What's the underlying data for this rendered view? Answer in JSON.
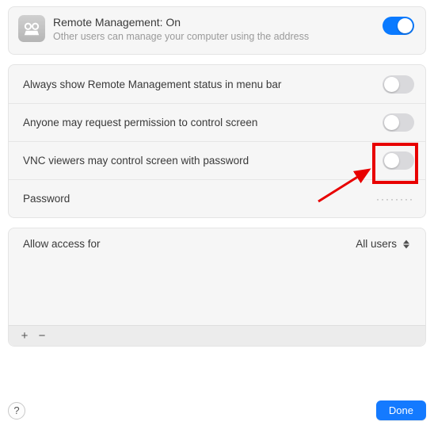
{
  "header": {
    "title": "Remote Management: On",
    "subtitle": "Other users can manage your computer using the address",
    "toggle_on": true
  },
  "settings": {
    "rows": [
      {
        "label": "Always show Remote Management status in menu bar",
        "toggle_on": false
      },
      {
        "label": "Anyone may request permission to control screen",
        "toggle_on": false
      },
      {
        "label": "VNC viewers may control screen with password",
        "toggle_on": false
      }
    ],
    "password_label": "Password",
    "password_value_masked": "········"
  },
  "access": {
    "label": "Allow access for",
    "selected": "All users"
  },
  "footer": {
    "add_symbol": "+",
    "remove_symbol": "−",
    "help_symbol": "?",
    "done_label": "Done"
  },
  "colors": {
    "accent": "#147aff",
    "annotation": "#e80000"
  }
}
